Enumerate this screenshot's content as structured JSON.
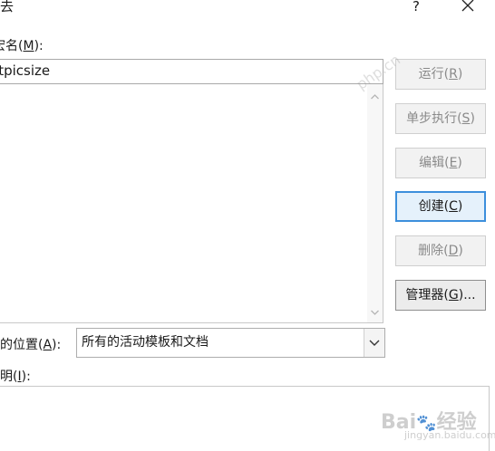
{
  "window": {
    "title_fragment": "去",
    "help_label": "?"
  },
  "macro_name": {
    "label_prefix": "宏名(",
    "label_key": "M",
    "label_suffix": "):",
    "value": "etpicsize"
  },
  "buttons": [
    {
      "id": "run",
      "text": "运行(",
      "key": "R",
      "suffix": ")",
      "enabled": false
    },
    {
      "id": "step",
      "text": "单步执行(",
      "key": "S",
      "suffix": ")",
      "enabled": false
    },
    {
      "id": "edit",
      "text": "编辑(",
      "key": "E",
      "suffix": ")",
      "enabled": false
    },
    {
      "id": "create",
      "text": "创建(",
      "key": "C",
      "suffix": ")",
      "enabled": true,
      "focused": true
    },
    {
      "id": "delete",
      "text": "删除(",
      "key": "D",
      "suffix": ")",
      "enabled": false
    },
    {
      "id": "organizer",
      "text": "管理器(",
      "key": "G",
      "suffix": ")...",
      "enabled": true
    }
  ],
  "location": {
    "label_prefix": "宏的位置(",
    "label_key": "A",
    "label_suffix": "):",
    "selected": "所有的活动模板和文档"
  },
  "description": {
    "label_prefix": "说明(",
    "label_key": "I",
    "label_suffix": "):"
  },
  "watermark": {
    "brand": "Bai",
    "brand_end": "经验",
    "site": "jingyan.baidu.com",
    "diag": "php.cn"
  },
  "colors": {
    "focus_border": "#3c8fdc",
    "disabled_text": "#8a8a8a"
  },
  "icons": {
    "close": "close-icon",
    "scroll_up": "chevron-up-icon",
    "scroll_down": "chevron-down-icon",
    "dropdown": "chevron-down-icon"
  }
}
